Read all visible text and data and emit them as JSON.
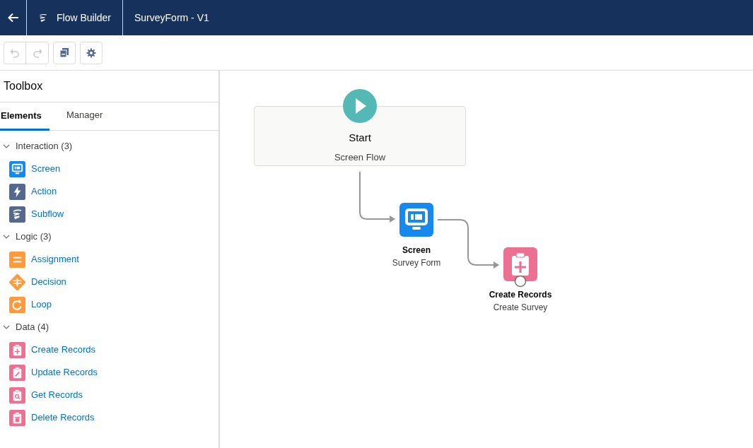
{
  "header": {
    "app_name": "Flow Builder",
    "flow_title": "SurveyForm - V1"
  },
  "toolbar": {
    "undo_disabled": true,
    "redo_disabled": true
  },
  "toolbox": {
    "title": "Toolbox",
    "tabs": [
      {
        "label": "Elements",
        "selected": true
      },
      {
        "label": "Manager",
        "selected": false
      }
    ],
    "sections": [
      {
        "label": "Interaction (3)",
        "expanded": true,
        "items": [
          {
            "label": "Screen",
            "kind": "screen"
          },
          {
            "label": "Action",
            "kind": "action"
          },
          {
            "label": "Subflow",
            "kind": "subflow"
          }
        ]
      },
      {
        "label": "Logic (3)",
        "expanded": true,
        "items": [
          {
            "label": "Assignment",
            "kind": "assignment"
          },
          {
            "label": "Decision",
            "kind": "decision"
          },
          {
            "label": "Loop",
            "kind": "loop"
          }
        ]
      },
      {
        "label": "Data (4)",
        "expanded": true,
        "items": [
          {
            "label": "Create Records",
            "kind": "create"
          },
          {
            "label": "Update Records",
            "kind": "update"
          },
          {
            "label": "Get Records",
            "kind": "get"
          },
          {
            "label": "Delete Records",
            "kind": "delete"
          }
        ]
      }
    ]
  },
  "canvas": {
    "start": {
      "title": "Start",
      "subtitle": "Screen Flow"
    },
    "nodes": [
      {
        "kind": "screen",
        "type_label": "Screen",
        "label": "Survey Form"
      },
      {
        "kind": "create",
        "type_label": "Create Records",
        "label": "Create Survey"
      }
    ]
  }
}
